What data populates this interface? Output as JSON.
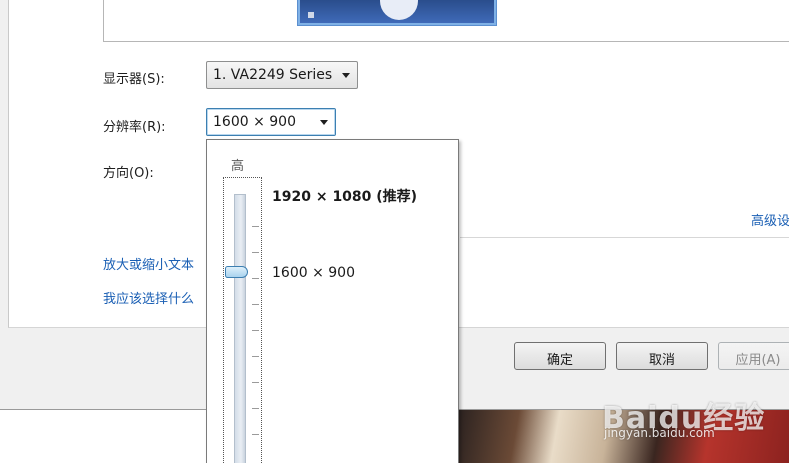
{
  "settings": {
    "display_label": "显示器(S):",
    "display_value": "1. VA2249 Series",
    "resolution_label": "分辨率(R):",
    "resolution_value": "1600 × 900",
    "orientation_label": "方向(O):"
  },
  "links": {
    "text_size": "放大或缩小文本",
    "which_settings": "我应该选择什么",
    "advanced": "高级设"
  },
  "buttons": {
    "ok": "确定",
    "cancel": "取消",
    "apply": "应用(A)"
  },
  "resolution_dropdown": {
    "high_label": "高",
    "options": [
      {
        "label": "1920 × 1080 (推荐)",
        "recommended": true
      },
      {
        "label": "1600 × 900",
        "selected": true
      }
    ],
    "slider_level_percent": 75
  },
  "watermark": {
    "main": "Baidu经验",
    "sub": "jingyan.baidu.com"
  },
  "colors": {
    "link": "#1a5fb4",
    "focus_border": "#3c7fb1",
    "dialog_bg": "#f0f0f0"
  }
}
